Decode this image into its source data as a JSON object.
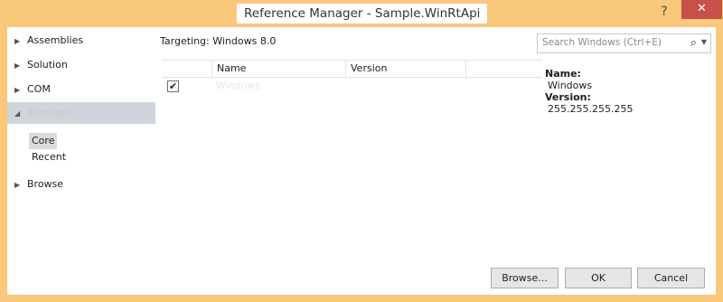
{
  "window": {
    "title": "Reference Manager - Sample.WinRtApi",
    "help_glyph": "?",
    "close_glyph": "✕"
  },
  "nav": {
    "items": [
      {
        "label": "Assemblies",
        "expanded": false
      },
      {
        "label": "Solution",
        "expanded": false
      },
      {
        "label": "COM",
        "expanded": false
      },
      {
        "label": "Windows",
        "expanded": true,
        "selected": true
      },
      {
        "label": "Browse",
        "expanded": false
      }
    ],
    "collapsed_glyph": "▶",
    "expanded_glyph": "◢",
    "subitems": [
      {
        "label": "Core",
        "selected": true
      },
      {
        "label": "Recent",
        "selected": false
      }
    ]
  },
  "main": {
    "targeting": "Targeting: Windows 8.0",
    "search": {
      "placeholder": "Search Windows (Ctrl+E)",
      "icon": "search-icon"
    },
    "columns": [
      "",
      "Name",
      "Version",
      ""
    ],
    "rows": [
      {
        "checked": true,
        "name": "Windows",
        "version": ""
      }
    ]
  },
  "details": {
    "name_label": "Name:",
    "name_value": "Windows",
    "version_label": "Version:",
    "version_value": "255.255.255.255"
  },
  "buttons": {
    "browse": "Browse...",
    "ok": "OK",
    "cancel": "Cancel"
  }
}
